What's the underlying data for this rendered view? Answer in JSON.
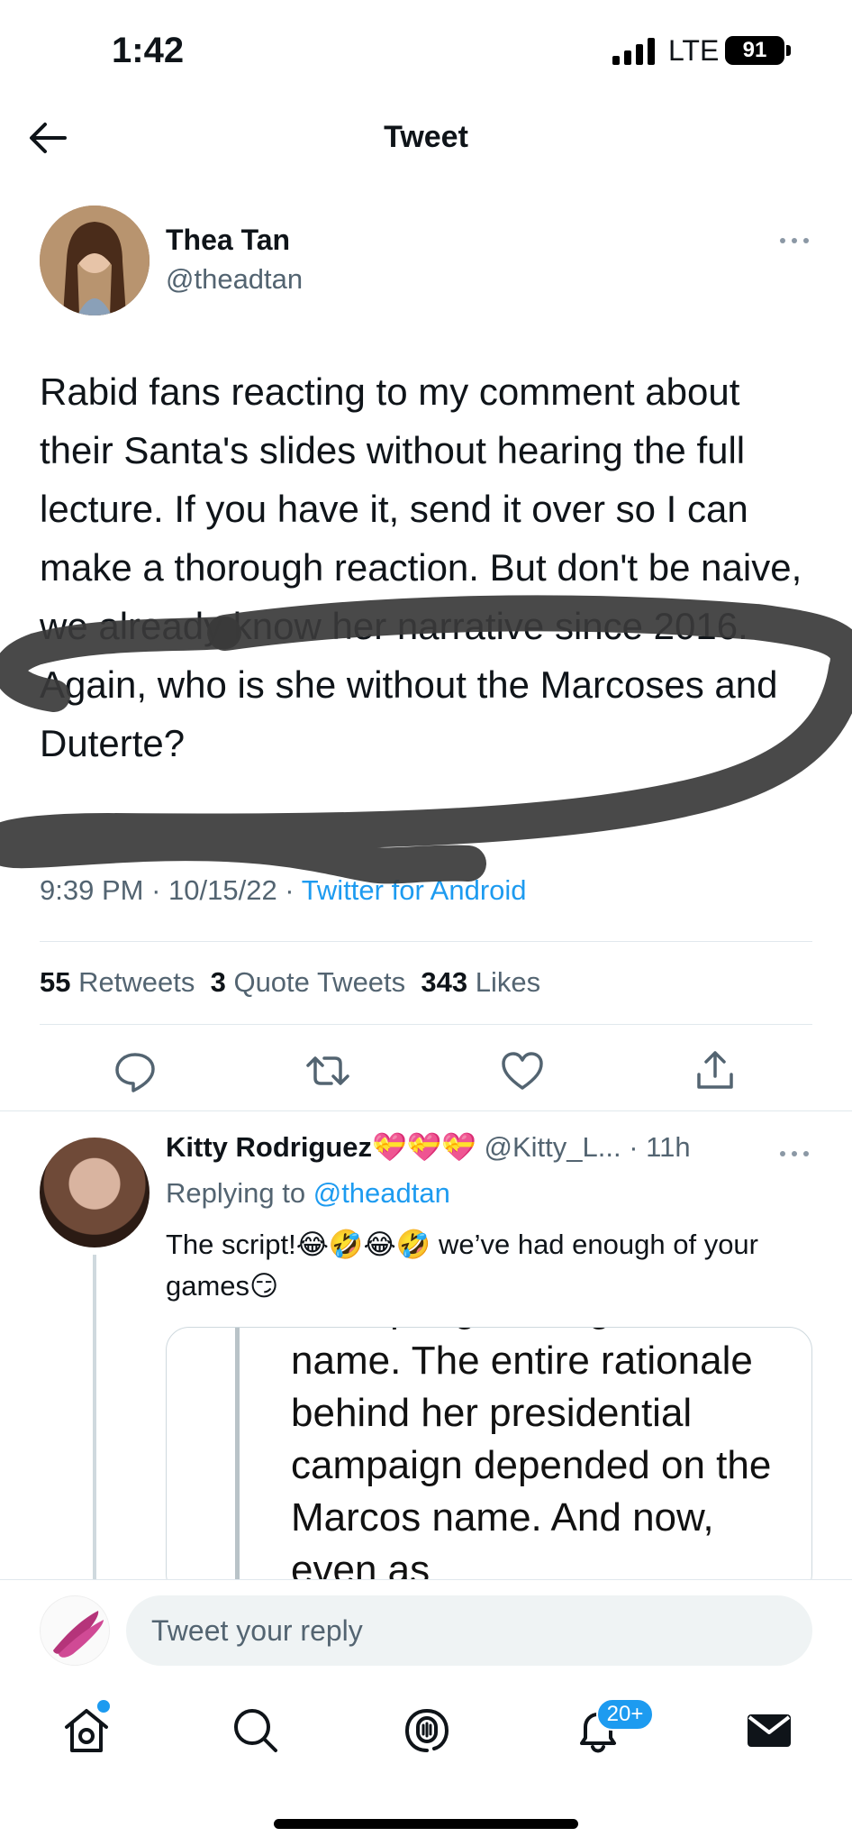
{
  "status_bar": {
    "time": "1:42",
    "network": "LTE",
    "battery": "91"
  },
  "header": {
    "title": "Tweet"
  },
  "tweet": {
    "author_name": "Thea Tan",
    "author_handle": "@theadtan",
    "text": "Rabid fans reacting to my comment about their Santa's slides without hearing the full lecture. If you have it, send it over so I can make a thorough reaction. But don't be naive, we already know her narrative since 2016. Again, who is she without the Marcoses and Duterte?",
    "time": "9:39 PM",
    "date": "10/15/22",
    "source": "Twitter for Android",
    "retweets_count": "55",
    "retweets_label": "Retweets",
    "quotes_count": "3",
    "quotes_label": "Quote Tweets",
    "likes_count": "343",
    "likes_label": "Likes"
  },
  "reply": {
    "name": "Kitty Rodriguez💝💝💝",
    "handle": "@Kitty_L...",
    "age": "11h",
    "replying_prefix": "Replying to",
    "replying_to": "@theadtan",
    "text": "The script!😂🤣😂🤣 we’ve had enough of your games😏",
    "quote_text": "attempting to drag PRRD's name. The entire rationale behind her presidential campaign depended on the Marcos name. And now, even as"
  },
  "compose": {
    "placeholder": "Tweet your reply"
  },
  "tabbar": {
    "notifications_badge": "20+"
  },
  "colors": {
    "accent": "#1d9bf0",
    "secondary_text": "#536471",
    "scribble": "#3a3a3a"
  },
  "icons": [
    "back-arrow-icon",
    "more-icon",
    "reply-icon",
    "retweet-icon",
    "like-icon",
    "share-icon",
    "home-icon",
    "search-icon",
    "spaces-icon",
    "notifications-icon",
    "messages-icon"
  ]
}
